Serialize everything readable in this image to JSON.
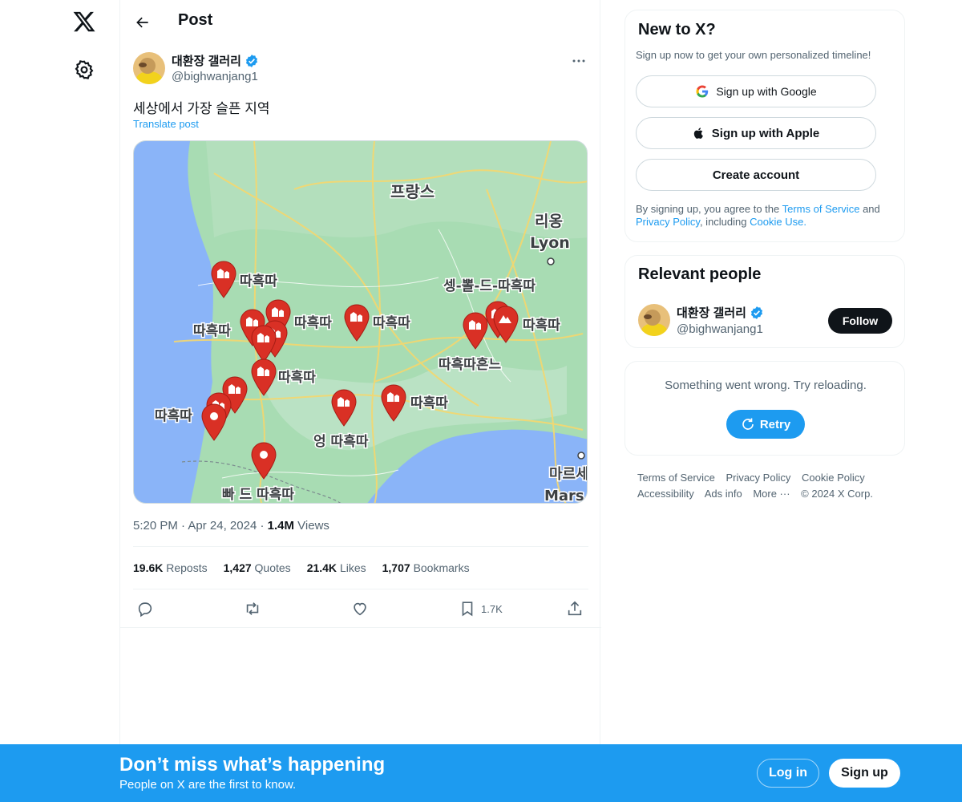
{
  "nav": {
    "logo": "x-logo-icon",
    "settings": "gear-icon"
  },
  "header": {
    "title": "Post",
    "back_icon": "arrow-left-icon"
  },
  "post": {
    "author_name": "대환장 갤러리",
    "author_handle": "@bighwanjang1",
    "text": "세상에서 가장 슬픈 지역",
    "translate": "Translate post",
    "time": "5:20 PM",
    "date": "Apr 24, 2024",
    "views_count": "1.4M",
    "views_label": "Views",
    "reposts_count": "19.6K",
    "reposts_label": "Reposts",
    "quotes_count": "1,427",
    "quotes_label": "Quotes",
    "likes_count": "21.4K",
    "likes_label": "Likes",
    "bookmarks_count": "1,707",
    "bookmarks_label": "Bookmarks",
    "bookmark_action_count": "1.7K"
  },
  "map": {
    "country": "프랑스",
    "city_ko": "리옹",
    "city_en": "Lyon",
    "city2_ko": "마르세",
    "city2_en": "Mars",
    "labels": [
      "따흑따",
      "따흑따",
      "따흑따",
      "따흑따",
      "따흑따",
      "따흑따",
      "따흑따",
      "셍-뽈-드-따흑따",
      "따흑따",
      "따흑따흔느",
      "엉 따흑따",
      "빠 드 따흑따"
    ]
  },
  "signup": {
    "title": "New to X?",
    "subtitle": "Sign up now to get your own personalized timeline!",
    "google": "Sign up with Google",
    "apple": "Sign up with Apple",
    "create": "Create account",
    "legal_1": "By signing up, you agree to the",
    "tos": "Terms of Service",
    "legal_2": "and",
    "privacy": "Privacy Policy",
    "legal_3": ", including",
    "cookie": "Cookie Use."
  },
  "relevant": {
    "title": "Relevant people",
    "name": "대환장 갤러리",
    "handle": "@bighwanjang1",
    "follow": "Follow"
  },
  "error": {
    "text": "Something went wrong. Try reloading.",
    "retry": "Retry"
  },
  "footer": {
    "links": [
      "Terms of Service",
      "Privacy Policy",
      "Cookie Policy",
      "Accessibility",
      "Ads info",
      "More ···",
      "© 2024 X Corp."
    ]
  },
  "banner": {
    "title": "Don’t miss what’s happening",
    "subtitle": "People on X are the first to know.",
    "login": "Log in",
    "signup": "Sign up"
  },
  "colors": {
    "accent": "#1d9bf0",
    "text": "#0f1419",
    "muted": "#536471"
  }
}
